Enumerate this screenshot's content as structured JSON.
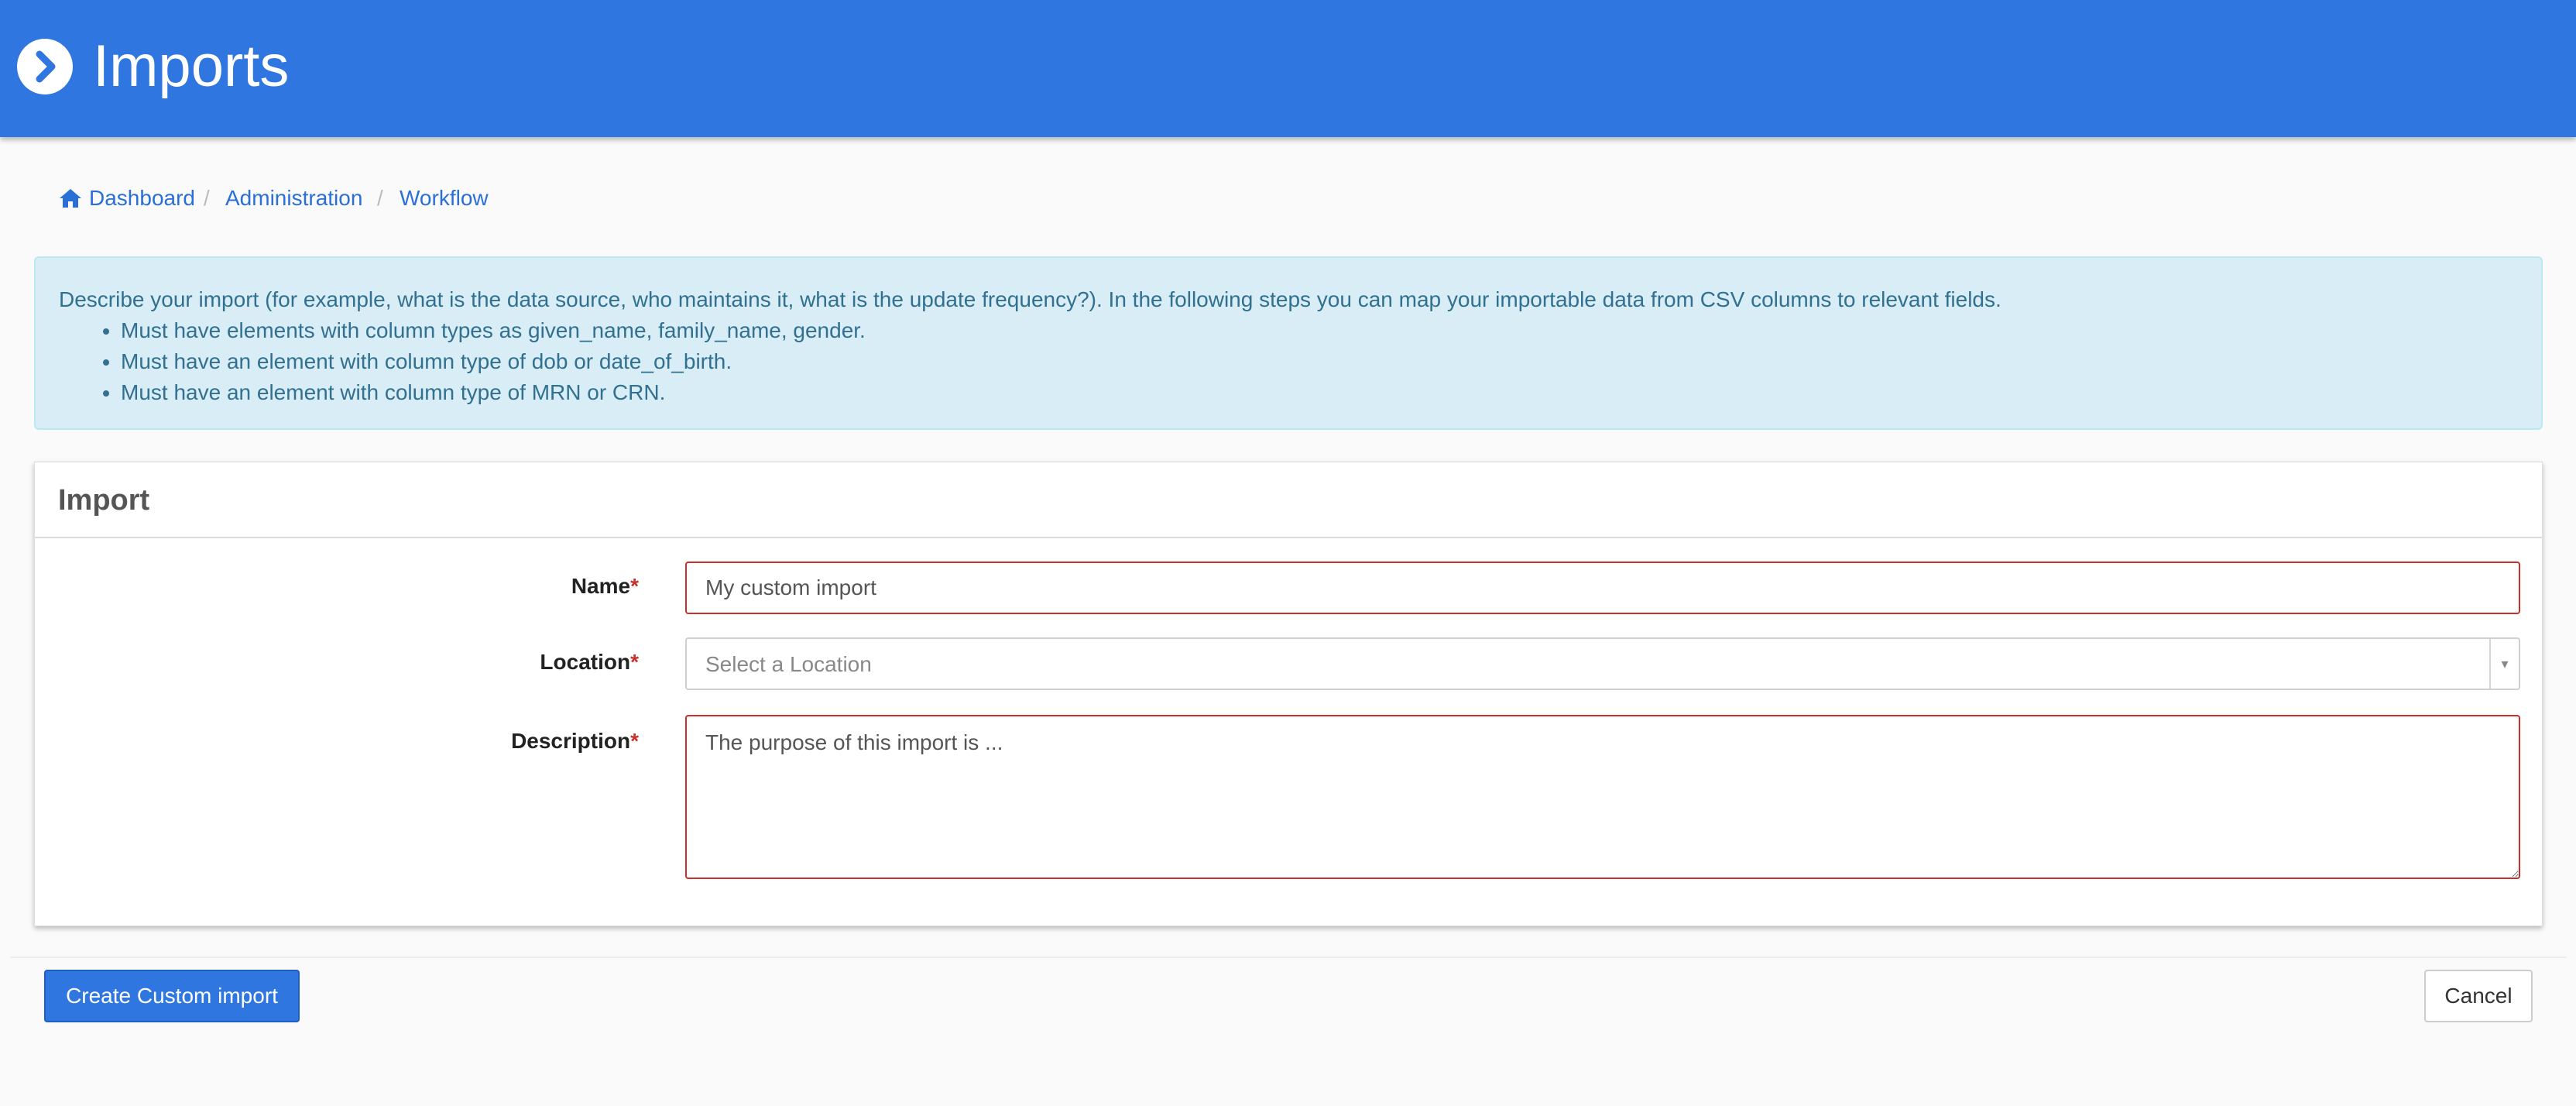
{
  "header": {
    "title": "Imports",
    "icon": "chevron-right-circle-icon",
    "bg_color": "#2f76e0"
  },
  "breadcrumb": {
    "items": [
      "Dashboard",
      "Administration",
      "Workflow"
    ],
    "separator": "/",
    "home_icon": "home-icon"
  },
  "alert": {
    "text": "Describe your import (for example, what is the data source, who maintains it, what is the update frequency?). In the following steps you can map your importable data from CSV columns to relevant fields.",
    "bullets": [
      "Must have elements with column types as given_name, family_name, gender.",
      "Must have an element with column type of dob or date_of_birth.",
      "Must have an element with column type of MRN or CRN."
    ]
  },
  "panel": {
    "title": "Import",
    "required_marker": "*",
    "fields": {
      "name": {
        "label": "Name",
        "value": "My custom import"
      },
      "location": {
        "label": "Location",
        "placeholder": "Select a Location",
        "arrow": "▾"
      },
      "description": {
        "label": "Description",
        "value": "The purpose of this import is ..."
      }
    }
  },
  "actions": {
    "create_label": "Create Custom import",
    "cancel_label": "Cancel"
  }
}
